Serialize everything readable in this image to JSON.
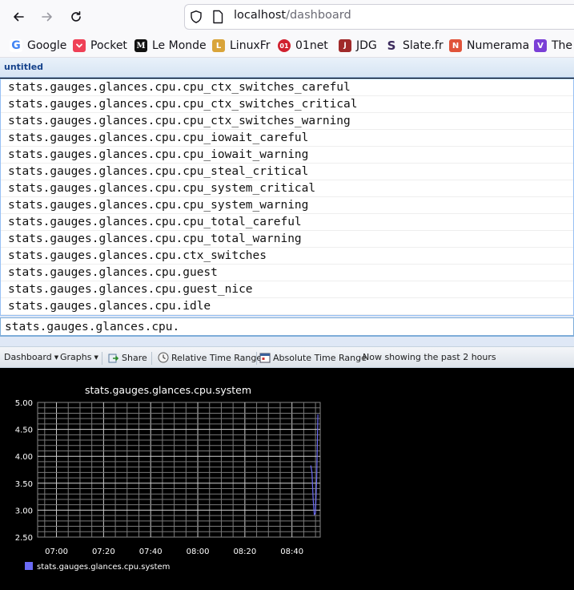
{
  "browser": {
    "url_host": "localhost",
    "url_path": "/dashboard",
    "bookmarks": [
      {
        "label": "Google",
        "icon": "google-icon",
        "color": "#4285f4"
      },
      {
        "label": "Pocket",
        "icon": "pocket-icon",
        "color": "#ef4056"
      },
      {
        "label": "Le Monde",
        "icon": "lemonde-icon",
        "color": "#111111"
      },
      {
        "label": "LinuxFr",
        "icon": "linuxfr-icon",
        "color": "#d9a43a"
      },
      {
        "label": "01net",
        "icon": "01net-icon",
        "color": "#d0202e"
      },
      {
        "label": "JDG",
        "icon": "jdg-icon",
        "color": "#a02a2a"
      },
      {
        "label": "Slate.fr",
        "icon": "slate-icon",
        "color": "#3b2a5c"
      },
      {
        "label": "Numerama",
        "icon": "numerama-icon",
        "color": "#e0533a"
      },
      {
        "label": "The V",
        "icon": "theverge-icon",
        "color": "#7a3fd6"
      }
    ]
  },
  "app": {
    "title": "untitled",
    "completions": [
      "stats.gauges.glances.cpu.cpu_ctx_switches_careful",
      "stats.gauges.glances.cpu.cpu_ctx_switches_critical",
      "stats.gauges.glances.cpu.cpu_ctx_switches_warning",
      "stats.gauges.glances.cpu.cpu_iowait_careful",
      "stats.gauges.glances.cpu.cpu_iowait_warning",
      "stats.gauges.glances.cpu.cpu_steal_critical",
      "stats.gauges.glances.cpu.cpu_system_critical",
      "stats.gauges.glances.cpu.cpu_system_warning",
      "stats.gauges.glances.cpu.cpu_total_careful",
      "stats.gauges.glances.cpu.cpu_total_warning",
      "stats.gauges.glances.cpu.ctx_switches",
      "stats.gauges.glances.cpu.guest",
      "stats.gauges.glances.cpu.guest_nice",
      "stats.gauges.glances.cpu.idle"
    ],
    "input_value": "stats.gauges.glances.cpu.",
    "toolbar": {
      "dashboard": "Dashboard",
      "graphs": "Graphs",
      "share": "Share",
      "relative": "Relative Time Range",
      "absolute": "Absolute Time Range",
      "status": "Now showing the past 2 hours"
    }
  },
  "colors": {
    "accent": "#15428b",
    "series": "#6b6bf5",
    "grid": "#bbbbbb"
  },
  "chart_data": {
    "type": "line",
    "title": "stats.gauges.glances.cpu.system",
    "xlabel": "",
    "ylabel": "",
    "x_ticks": [
      "07:00",
      "07:20",
      "07:40",
      "08:00",
      "08:20",
      "08:40"
    ],
    "y_ticks": [
      "2.50",
      "3.00",
      "3.50",
      "4.00",
      "4.50",
      "5.00"
    ],
    "ylim": [
      2.5,
      5.0
    ],
    "xlim": [
      "06:52",
      "08:52"
    ],
    "grid": true,
    "legend_position": "bottom-left",
    "series": [
      {
        "name": "stats.gauges.glances.cpu.system",
        "x": [
          "08:48",
          "08:48.5",
          "08:49",
          "08:49.5",
          "08:50",
          "08:50.5",
          "08:51"
        ],
        "values": [
          3.83,
          3.7,
          3.2,
          2.92,
          2.95,
          3.6,
          4.78
        ]
      }
    ]
  }
}
